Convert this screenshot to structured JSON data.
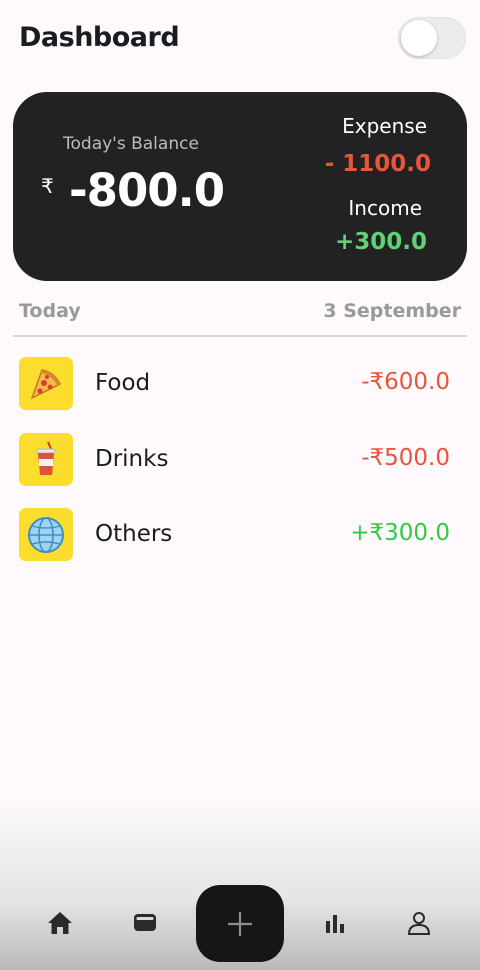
{
  "header": {
    "title": "Dashboard",
    "theme_toggle": "off"
  },
  "balance_card": {
    "label": "Today's Balance",
    "currency": "₹",
    "amount": "-800.0",
    "expense_label": "Expense",
    "expense_amount": "- 1100.0",
    "income_label": "Income",
    "income_amount": "+300.0"
  },
  "date_row": {
    "day": "Today",
    "date": "3 September"
  },
  "transactions": [
    {
      "icon": "pizza-icon",
      "name": "Food",
      "amount": "-₹600.0",
      "color": "#e9553a"
    },
    {
      "icon": "drink-cup-icon",
      "name": "Drinks",
      "amount": "-₹500.0",
      "color": "#e9553a"
    },
    {
      "icon": "globe-icon",
      "name": "Others",
      "amount": "+₹300.0",
      "color": "#2ecc40"
    }
  ],
  "bottom_nav": [
    "home-icon",
    "wallet-icon",
    "add-icon",
    "stats-icon",
    "profile-icon"
  ],
  "colors": {
    "card": "#222222",
    "expense": "#e9553a",
    "income": "#5ed274",
    "icon_bg": "#fbdd2e"
  }
}
